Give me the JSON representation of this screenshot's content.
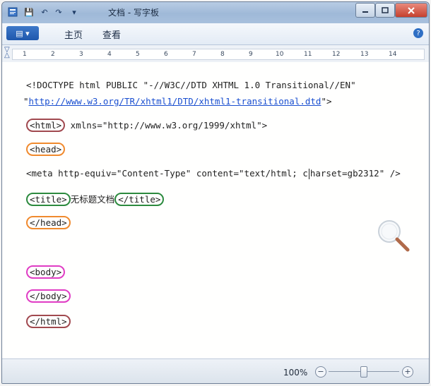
{
  "titlebar": {
    "title": "文档 - 写字板",
    "quick_access": [
      "💾",
      "↶",
      "↷",
      "▾"
    ]
  },
  "ribbon": {
    "file_button": "▤ ▾",
    "tabs": [
      "主页",
      "查看"
    ],
    "help_label": "?"
  },
  "ruler": {
    "ticks": [
      "1",
      "2",
      "3",
      "4",
      "5",
      "6",
      "7",
      "8",
      "9",
      "10",
      "11",
      "12",
      "13",
      "14"
    ]
  },
  "document": {
    "doctype_line1": "<!DOCTYPE html PUBLIC \"-//W3C//DTD XHTML 1.0 Transitional//EN\"",
    "doctype_line2_link": "http://www.w3.org/TR/xhtml1/DTD/xhtml1-transitional.dtd",
    "html_open_tag": "<html>",
    "html_open_attr": " xmlns=\"http://www.w3.org/1999/xhtml\">",
    "head_open": "<head>",
    "meta_line_a": "<meta http-equiv=\"Content-Type\" content=\"text/html; c",
    "meta_line_b": "harset=gb2312\" />",
    "title_open": "<title>",
    "title_text": "无标题文档",
    "title_close": "</title>",
    "head_close": "</head>",
    "body_open": "<body>",
    "body_close": "</body>",
    "html_close": "</html>"
  },
  "statusbar": {
    "zoom": "100%",
    "zoom_out": "−",
    "zoom_in": "+",
    "zoom_level_fraction": 0.5
  },
  "colors": {
    "annotation_html": "#a1494f",
    "annotation_head": "#f08a2e",
    "annotation_title": "#2c8a3e",
    "annotation_body": "#e03cc4",
    "link": "#1a4fd0"
  }
}
